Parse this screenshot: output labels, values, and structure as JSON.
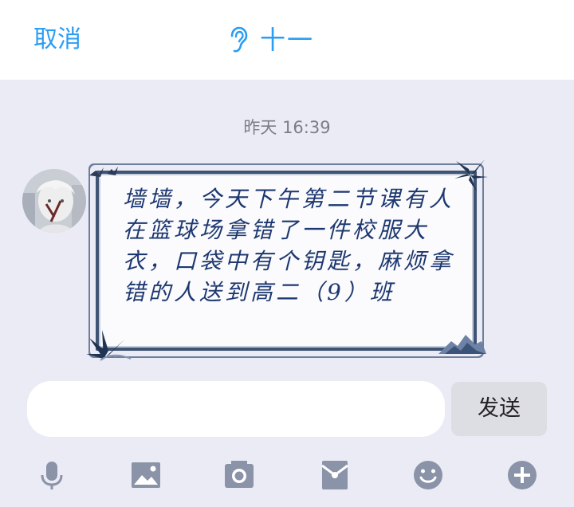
{
  "header": {
    "cancel_label": "取消",
    "title": "十一"
  },
  "chat": {
    "timestamp": "昨天 16:39",
    "message": "墙墙，今天下午第二节课有人在篮球场拿错了一件校服大衣，口袋中有个钥匙，麻烦拿错的人送到高二（9）班"
  },
  "composer": {
    "input_value": "",
    "send_label": "发送"
  },
  "toolbar": {
    "icons": [
      "microphone-icon",
      "image-icon",
      "camera-icon",
      "red-packet-icon",
      "emoji-icon",
      "plus-icon"
    ]
  },
  "colors": {
    "accent": "#2a9df4",
    "background": "#ebebf5",
    "bubble_text": "#1d3870",
    "toolbar_icon": "#8a93a8"
  }
}
